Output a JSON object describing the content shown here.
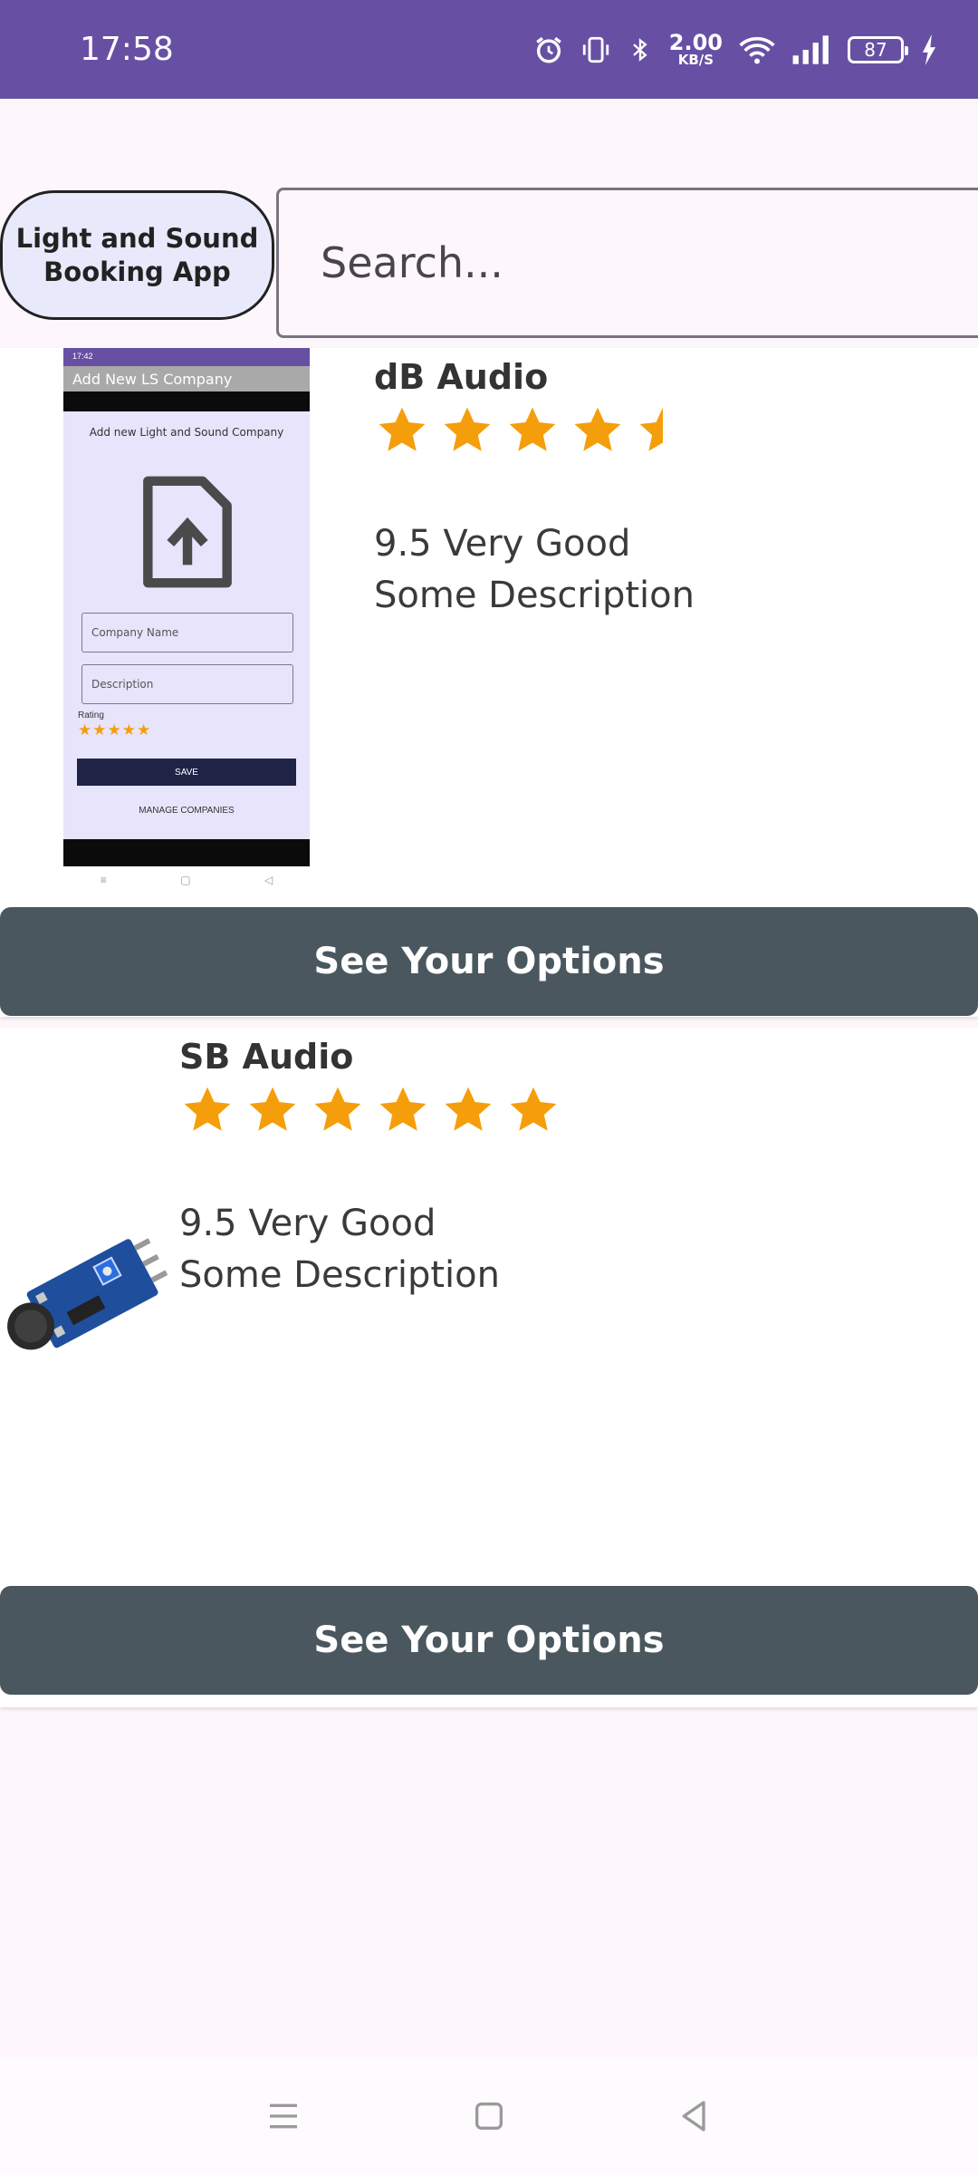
{
  "status_bar": {
    "time": "17:58",
    "net_speed_value": "2.00",
    "net_speed_unit": "KB/S",
    "battery": "87",
    "icons": [
      "alarm-icon",
      "vibrate-icon",
      "bluetooth-icon",
      "wifi-icon",
      "signal-icon",
      "battery-icon",
      "charging-icon"
    ]
  },
  "header": {
    "app_title": "Light and Sound Booking App",
    "search_placeholder": "Search..."
  },
  "companies": [
    {
      "name": "dB Audio",
      "stars": 4.5,
      "rating_text": "9.5 Very Good",
      "description": "Some Description",
      "button_label": "See Your Options",
      "thumbnail": {
        "status_time": "17:42",
        "appbar_title": "Add New LS Company",
        "heading": "Add new Light and Sound Company",
        "company_name_placeholder": "Company Name",
        "description_placeholder": "Description",
        "rating_label": "Rating",
        "save_label": "SAVE",
        "manage_label": "MANAGE COMPANIES"
      }
    },
    {
      "name": "SB Audio",
      "stars": 6,
      "rating_text": "9.5 Very Good",
      "description": "Some Description",
      "button_label": "See Your Options"
    }
  ],
  "colors": {
    "status_bar": "#6750a4",
    "button": "#4a575f",
    "star": "#f59e0b"
  }
}
